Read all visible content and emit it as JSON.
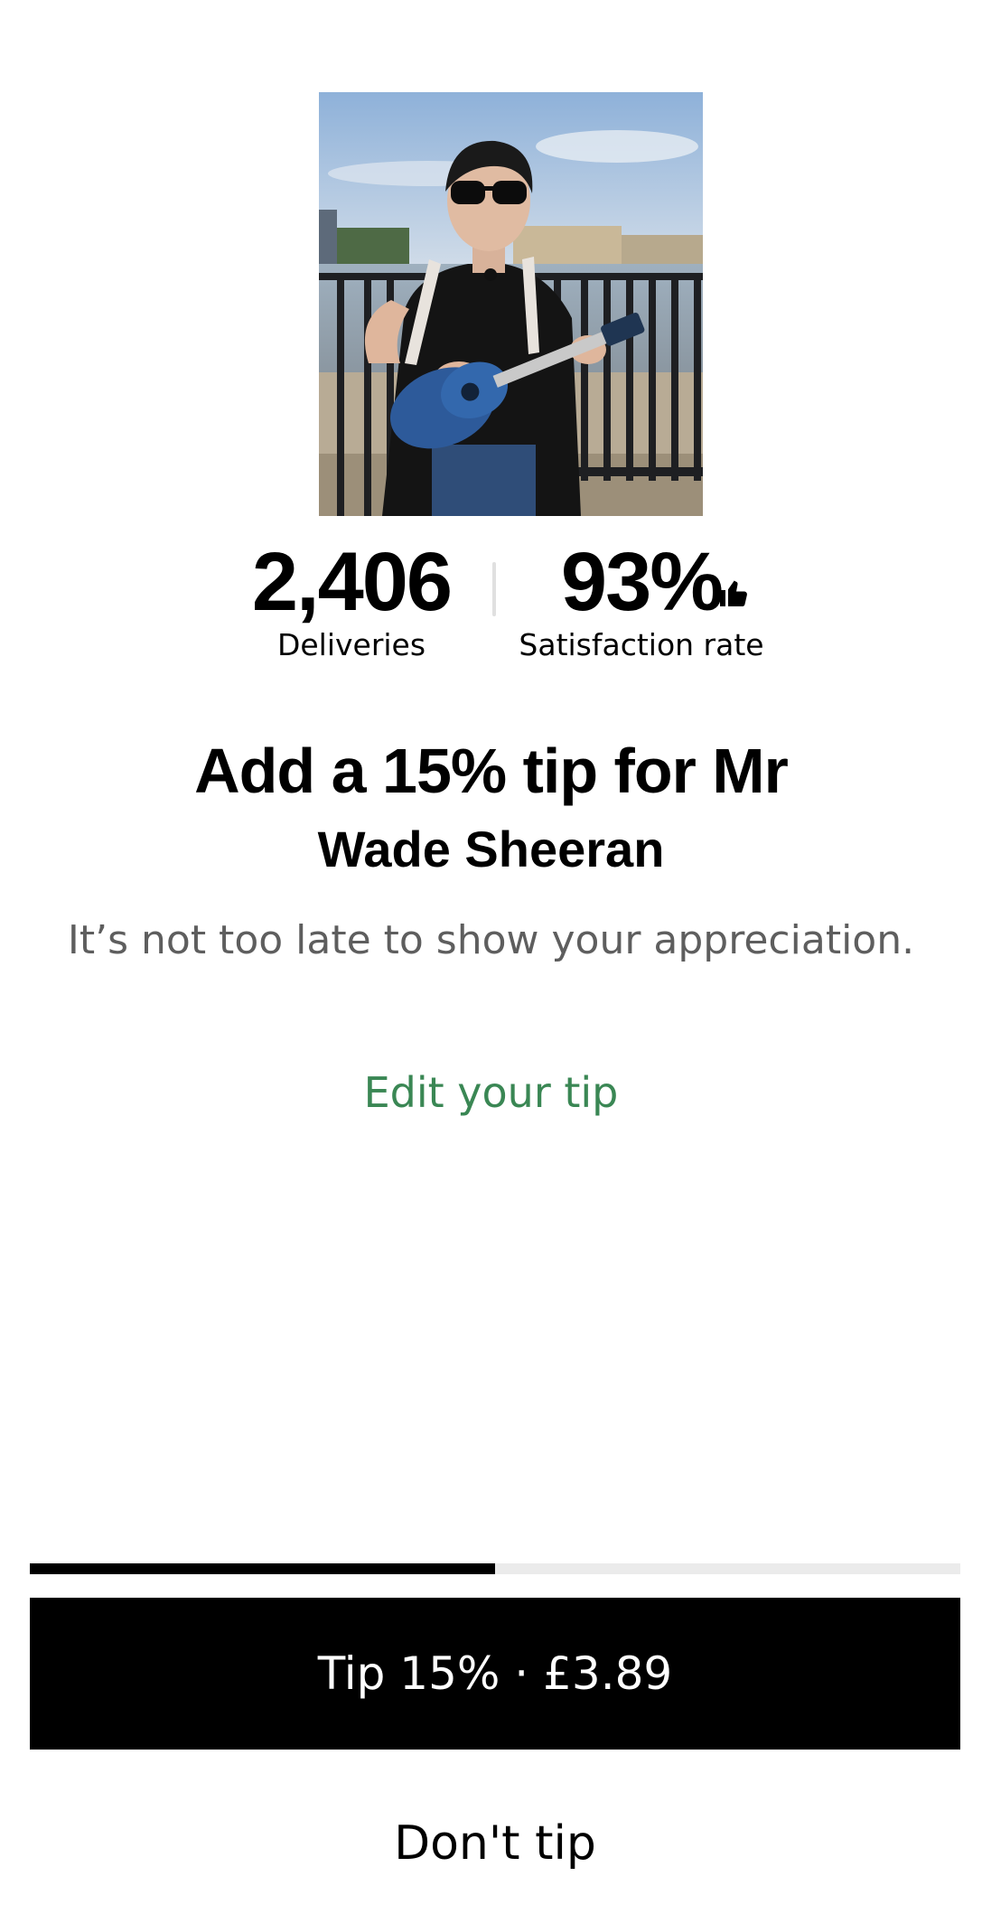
{
  "courier": {
    "photo_alt": "Courier photo",
    "deliveries_value": "2,406",
    "deliveries_label": "Deliveries",
    "satisfaction_value": "93%",
    "satisfaction_label": "Satisfaction rate",
    "satisfaction_icon": "thumbs-up-icon"
  },
  "prompt": {
    "title": "Add a 15% tip for Mr",
    "name": "Wade Sheeran",
    "subtitle": "It’s not too late to show your appreciation.",
    "edit_link": "Edit your tip"
  },
  "progress": {
    "fraction": 0.5
  },
  "actions": {
    "tip_label": "Tip 15% · £3.89",
    "no_tip_label": "Don't tip"
  },
  "colors": {
    "accent_link": "#3a8754",
    "primary_button": "#000000",
    "progress_fill": "#000000",
    "progress_track": "#ebebeb"
  }
}
